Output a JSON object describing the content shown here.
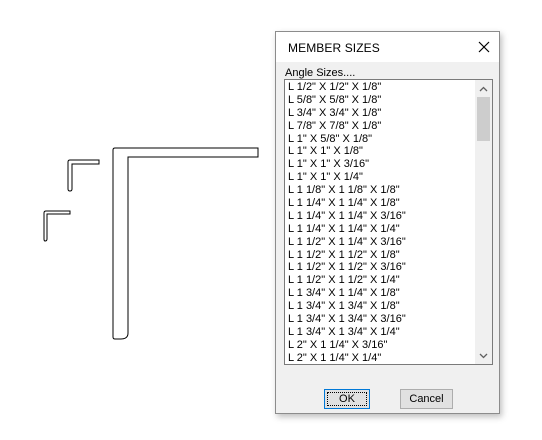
{
  "dialog": {
    "title": "MEMBER SIZES",
    "group_label": "Angle Sizes....",
    "items": [
      "L 1/2\" X 1/2\" X 1/8\"",
      "L 5/8\" X 5/8\" X 1/8\"",
      "L 3/4\" X 3/4\" X 1/8\"",
      "L 7/8\" X 7/8\" X 1/8\"",
      "L 1\" X 5/8\" X 1/8\"",
      "L 1\" X 1\" X 1/8\"",
      "L 1\" X 1\" X 3/16\"",
      "L 1\" X 1\" X 1/4\"",
      "L 1 1/8\" X 1 1/8\" X 1/8\"",
      "L 1 1/4\" X 1 1/4\" X 1/8\"",
      "L 1 1/4\" X 1 1/4\" X 3/16\"",
      "L 1 1/4\" X 1 1/4\" X 1/4\"",
      "L 1 1/2\" X 1 1/4\" X 3/16\"",
      "L 1 1/2\" X 1 1/2\" X 1/8\"",
      "L 1 1/2\" X 1 1/2\" X 3/16\"",
      "L 1 1/2\" X 1 1/2\" X 1/4\"",
      "L 1 3/4\" X 1 1/4\" X 1/8\"",
      "L 1 3/4\" X 1 3/4\" X 1/8\"",
      "L 1 3/4\" X 1 3/4\" X 3/16\"",
      "L 1 3/4\" X 1 3/4\" X 1/4\"",
      "L 2\" X 1 1/4\" X 3/16\"",
      "L 2\" X 1 1/4\" X 1/4\""
    ],
    "ok_label": "OK",
    "cancel_label": "Cancel",
    "close_icon": "close-icon",
    "scroll_up_icon": "chevron-up-icon",
    "scroll_down_icon": "chevron-down-icon"
  },
  "colors": {
    "dialog_bg": "#f0f0f0",
    "titlebar_bg": "#ffffff",
    "ok_border_accent": "#0078d7",
    "scroll_thumb": "#cdcdcd"
  }
}
